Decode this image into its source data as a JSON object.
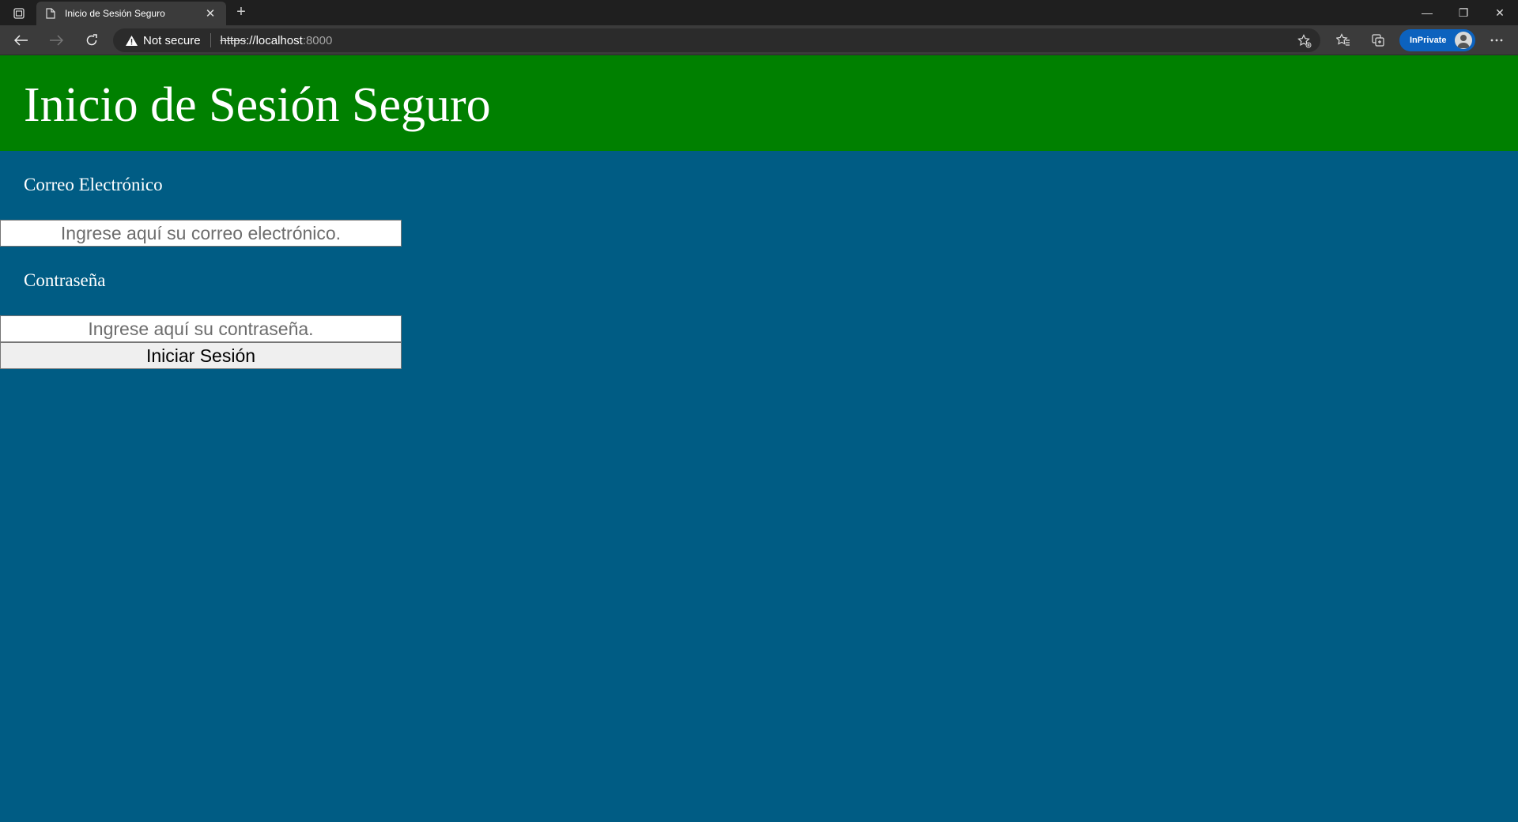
{
  "browser": {
    "tab_title": "Inicio de Sesión Seguro",
    "security_label": "Not secure",
    "url_scheme": "https",
    "url_host": "://localhost",
    "url_port": ":8000",
    "inprivate_label": "InPrivate",
    "accent_color": "#0c62be"
  },
  "page": {
    "title": "Inicio de Sesión Seguro",
    "header_color": "#008000",
    "background_color": "#005c84",
    "email_label": "Correo Electrónico",
    "email_placeholder": "Ingrese aquí su correo electrónico.",
    "password_label": "Contraseña",
    "password_placeholder": "Ingrese aquí su contraseña.",
    "submit_label": "Iniciar Sesión"
  }
}
